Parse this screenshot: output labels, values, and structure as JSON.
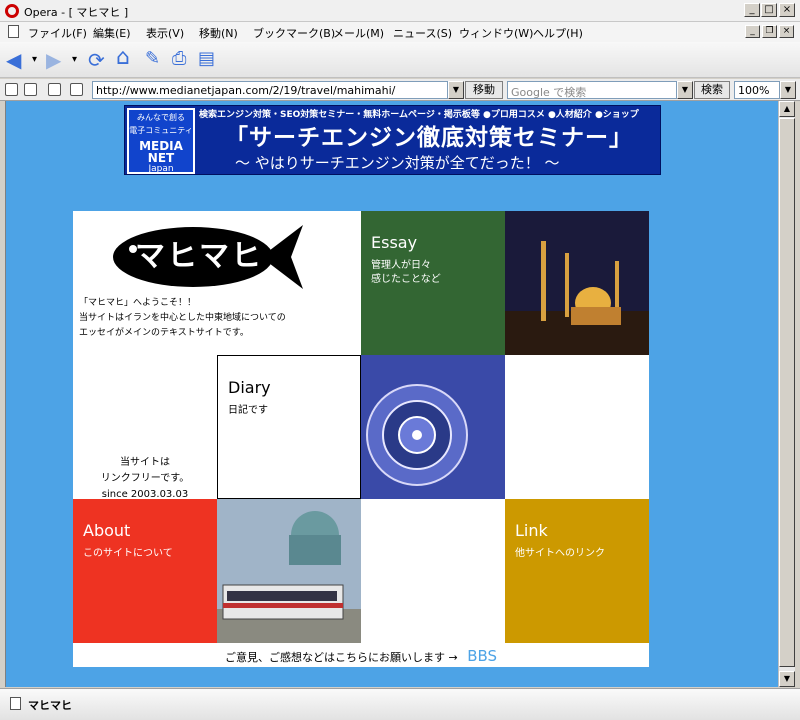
{
  "window": {
    "title": "Opera - [ マヒマヒ ]",
    "minimize": "_",
    "maximize": "□",
    "close": "×",
    "mdi_minimize": "_",
    "mdi_restore": "❐",
    "mdi_close": "×"
  },
  "menu": [
    "ファイル(F)",
    "編集(E)",
    "表示(V)",
    "移動(N)",
    "ブックマーク(B)",
    "メール(M)",
    "ニュース(S)",
    "ウィンドウ(W)",
    "ヘルプ(H)"
  ],
  "toolbar": {
    "back": "◀",
    "forward": "▶",
    "dropdown": "▾",
    "reload": "⟳",
    "home": "⌂",
    "hotlist": "✎",
    "print": "⎙",
    "notes": "▤"
  },
  "address": {
    "url": "http://www.medianetjapan.com/2/19/travel/mahimahi/",
    "go_label": "移動",
    "search_placeholder": "Google で検索",
    "search_label": "検索",
    "zoom": "100%",
    "dropdown": "▼"
  },
  "scrollbar": {
    "up": "▲",
    "down": "▼"
  },
  "status": {
    "text": "マヒマヒ"
  },
  "banner": {
    "logo_line1": "みんなで創る",
    "logo_line2": "電子コミュニティ",
    "logo_line3": "MEDIA NET",
    "logo_line4": "Japan",
    "topline": "検索エンジン対策・SEO対策セミナー・無料ホームページ・掲示板等 ●プロ用コスメ ●人材紹介 ●ショップ",
    "main": "「サーチエンジン徹底対策セミナー」",
    "sub": "～ やはりサーチエンジン対策が全てだった！ ～"
  },
  "site": {
    "logo_text": "マヒマヒ",
    "intro": [
      "「マヒマヒ」へようこそ！！",
      "当サイトはイランを中心とした中東地域についての",
      "エッセイがメインのテキストサイトです。"
    ],
    "linkfree": [
      "当サイトは",
      "リンクフリーです。",
      "since 2003.03.03"
    ],
    "essay": {
      "title": "Essay",
      "sub": [
        "管理人が日々",
        "感じたことなど"
      ]
    },
    "diary": {
      "title": "Diary",
      "sub": "日記です"
    },
    "about": {
      "title": "About",
      "sub": "このサイトについて"
    },
    "link": {
      "title": "Link",
      "sub": "他サイトへのリンク"
    },
    "footer_text": "ご意見、ご感想などはこちらにお願いします →",
    "bbs": "BBS"
  },
  "colors": {
    "page_bg": "#4da3e6",
    "essay": "#336633",
    "about": "#ee3322",
    "link": "#cc9900",
    "banner": "#0a2a9a"
  }
}
